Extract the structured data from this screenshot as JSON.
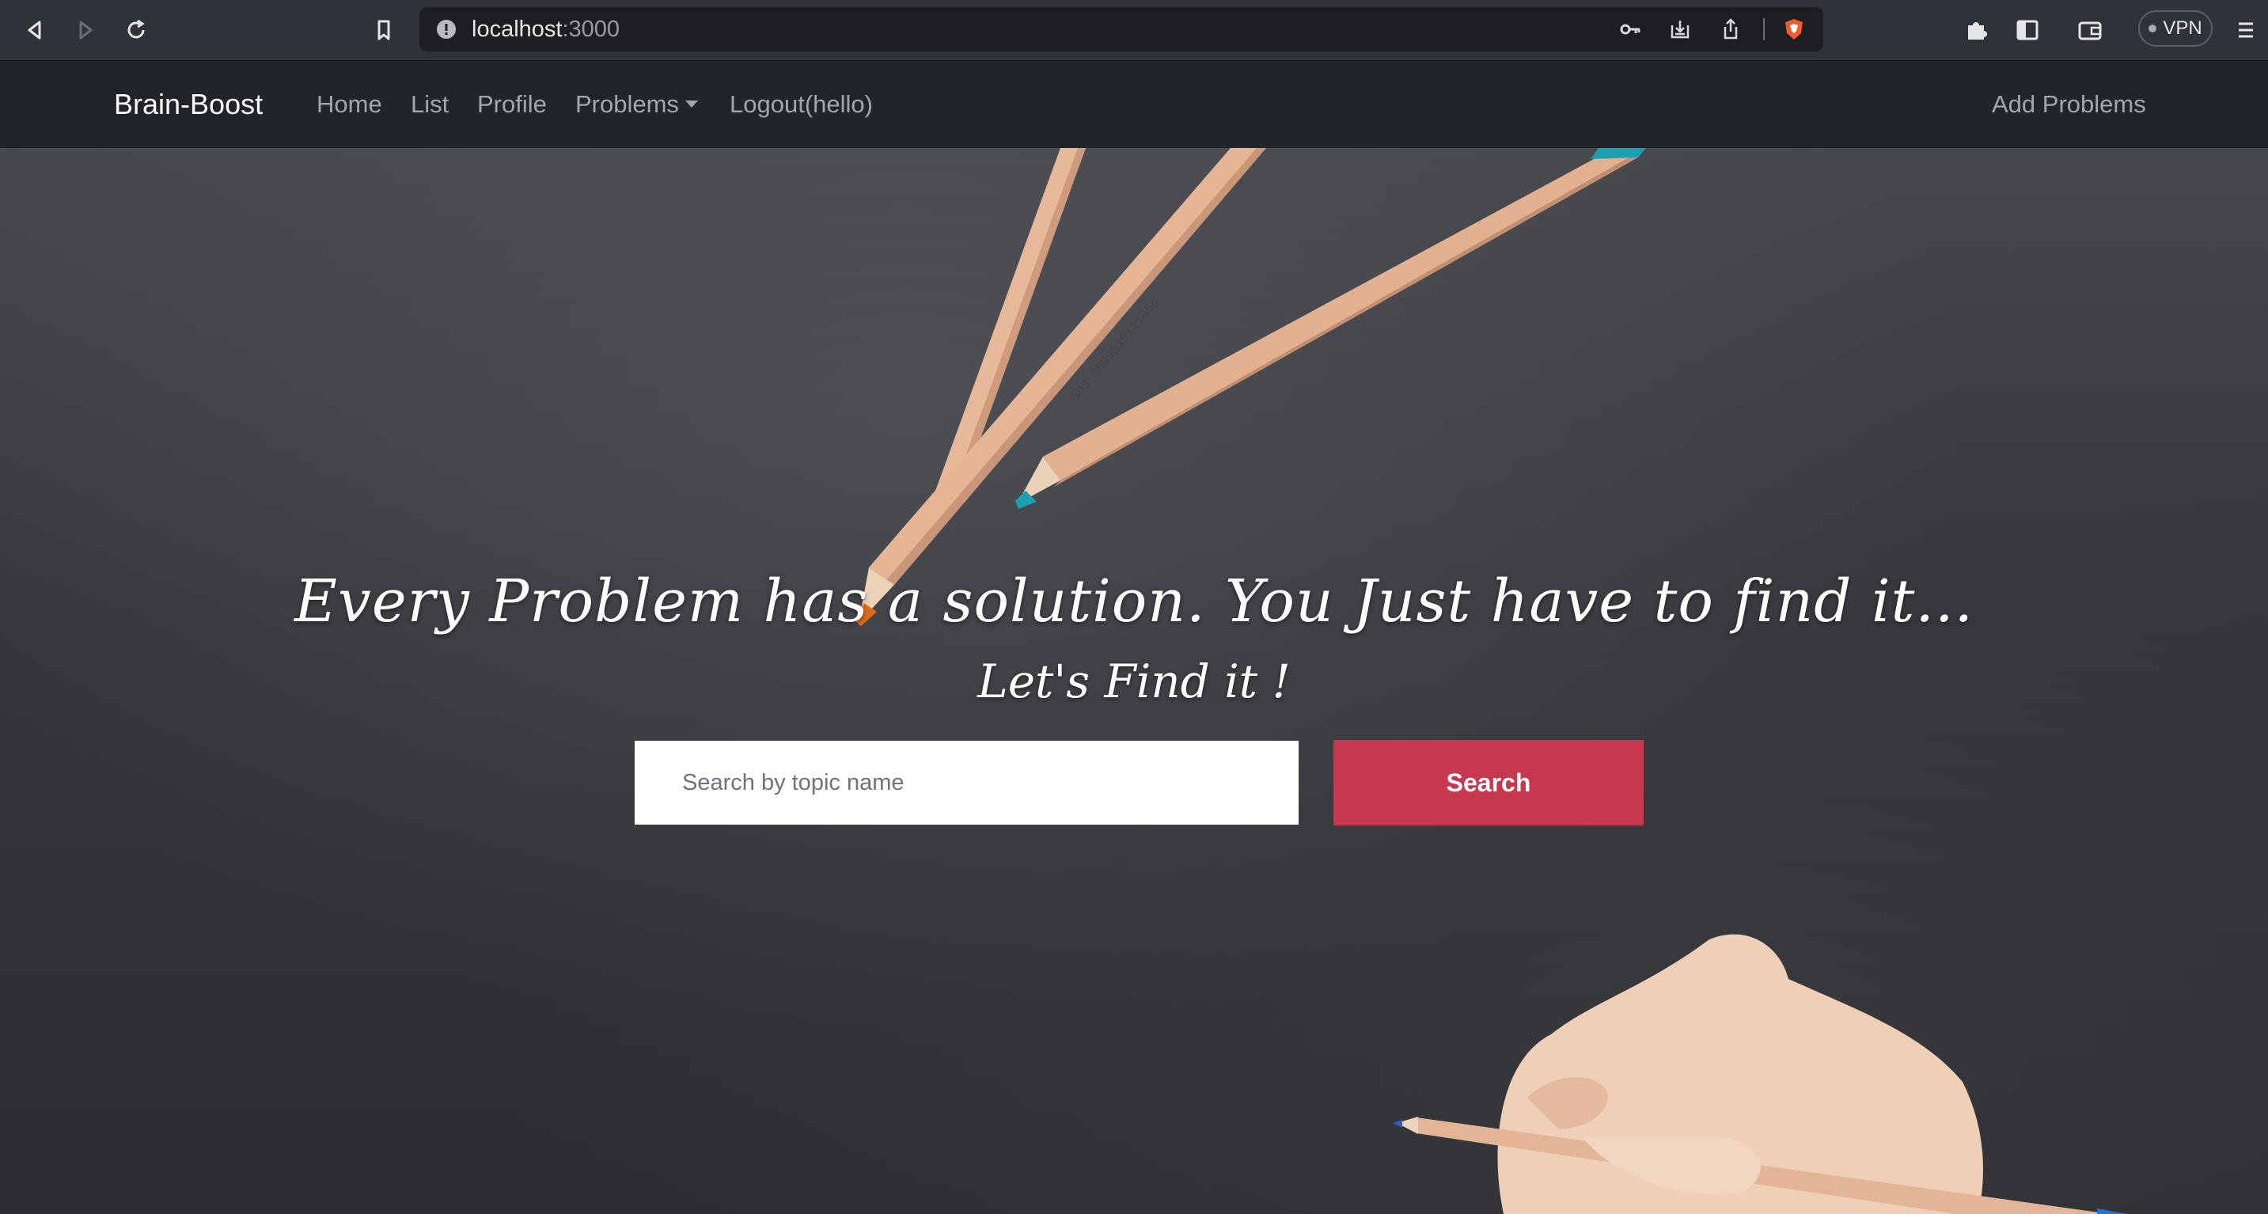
{
  "browser": {
    "url_host": "localhost",
    "url_port": ":3000",
    "vpn_label": "VPN",
    "icons": [
      "back-icon",
      "forward-icon",
      "reload-icon",
      "bookmark-icon",
      "site-info-icon",
      "key-icon",
      "install-icon",
      "share-icon",
      "brave-shield-icon",
      "extensions-icon",
      "sidebar-icon",
      "wallet-icon",
      "menu-icon"
    ]
  },
  "navbar": {
    "brand": "Brain-Boost",
    "links": {
      "home": "Home",
      "list": "List",
      "profile": "Profile",
      "problems": "Problems",
      "logout": "Logout(hello)",
      "add_problems": "Add Problems"
    }
  },
  "hero": {
    "headline": "Every Problem has a solution. You Just have to find it...",
    "subline": "Let's Find it !",
    "search_placeholder": "Search by topic name",
    "search_button": "Search"
  },
  "colors": {
    "navbar_bg": "#212529",
    "search_button": "#c7384f",
    "chrome_bg": "#30323a"
  }
}
